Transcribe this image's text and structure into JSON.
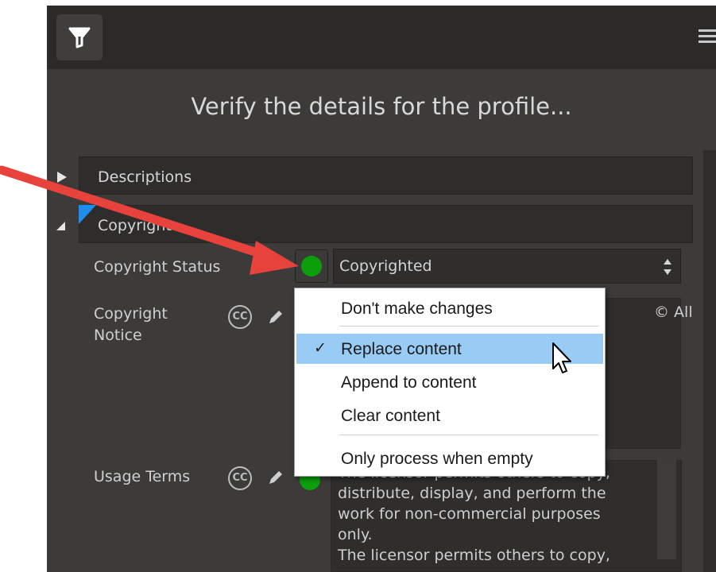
{
  "header": {
    "filter_icon": "filter-icon",
    "menu_icon": "hamburger-menu-icon"
  },
  "title": "Verify the details for the profile...",
  "sections": {
    "descriptions": "Descriptions",
    "copyright": "Copyright"
  },
  "copyright_status": {
    "label": "Copyright Status",
    "status_color": "#0c9f0c",
    "value": "Copyrighted"
  },
  "copyright_notice": {
    "label_line1": "Copyright",
    "label_line2": "Notice",
    "cc_icon_text": "CC",
    "partial_text": "© All"
  },
  "usage_terms": {
    "label": "Usage Terms",
    "cc_icon_text": "CC",
    "lines": [
      "The licensor permits others to copy,",
      "distribute, display, and perform the",
      "work for non-commercial purposes",
      "only.",
      "The licensor permits others to copy,"
    ]
  },
  "dropdown": {
    "items": [
      {
        "label": "Don't make changes",
        "selected": false
      },
      {
        "label": "Replace content",
        "selected": true
      },
      {
        "label": "Append to content",
        "selected": false
      },
      {
        "label": "Clear content",
        "selected": false
      },
      {
        "label": "Only process when empty",
        "selected": false
      }
    ],
    "check_glyph": "✓",
    "highlight_color": "#99ccf5"
  },
  "annotation": {
    "arrow_color": "#e8423d"
  }
}
